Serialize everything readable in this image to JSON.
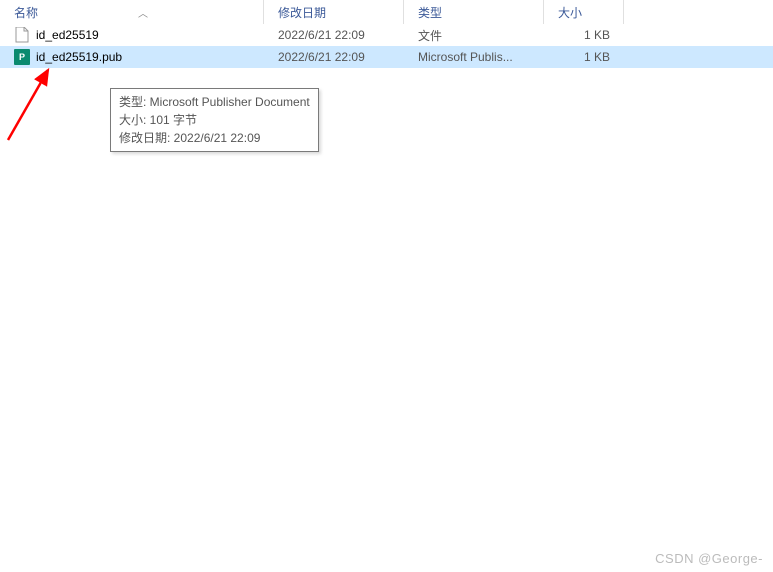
{
  "columns": {
    "name": "名称",
    "date": "修改日期",
    "type": "类型",
    "size": "大小"
  },
  "rows": [
    {
      "name": "id_ed25519",
      "date": "2022/6/21 22:09",
      "type": "文件",
      "size": "1 KB",
      "icon": "file",
      "selected": false
    },
    {
      "name": "id_ed25519.pub",
      "date": "2022/6/21 22:09",
      "type": "Microsoft Publis...",
      "size": "1 KB",
      "icon": "pub",
      "selected": true
    }
  ],
  "tooltip": {
    "line1": "类型: Microsoft Publisher Document",
    "line2": "大小: 101 字节",
    "line3": "修改日期: 2022/6/21 22:09"
  },
  "watermark": "CSDN @George-"
}
